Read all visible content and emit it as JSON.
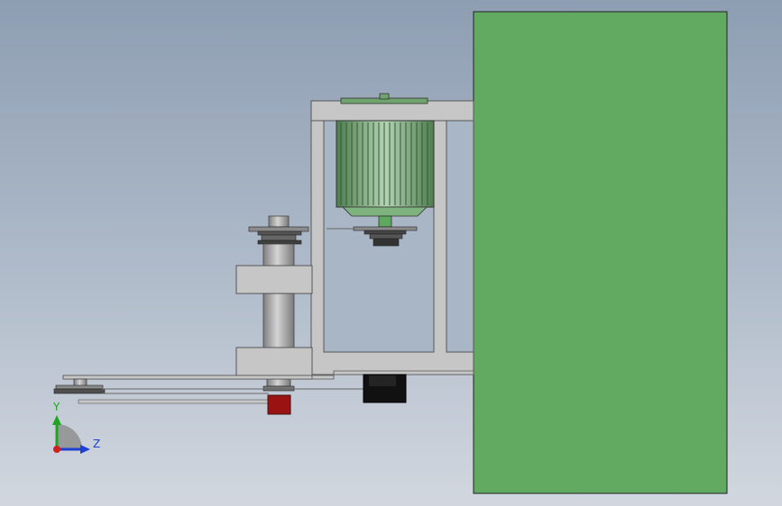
{
  "viewport": {
    "background_top": "#8e9eb2",
    "background_bottom": "#d2d7df"
  },
  "triad": {
    "y_label": "Y",
    "z_label": "Z",
    "y_color": "#1fa51f",
    "z_color": "#1f3fd0",
    "x_color": "#d01f1f"
  },
  "colors": {
    "panel_green": "#62aa62",
    "motor_green": "#70a870",
    "frame_gray": "#c6c6c6",
    "steel_gray": "#9a9a9a",
    "dark_pulley": "#3f3f3f",
    "red_block": "#9a1212",
    "black_block": "#111111"
  },
  "icons": {
    "triad": "coordinate-triad-icon"
  }
}
